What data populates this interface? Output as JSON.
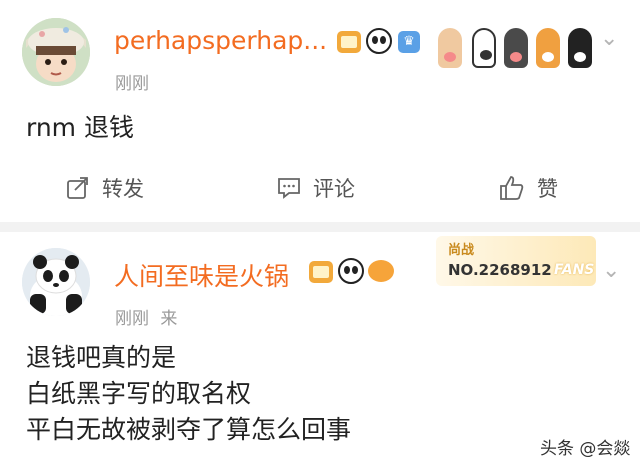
{
  "posts": [
    {
      "username": "perhapsperhap...",
      "time": "刚刚",
      "text_lines": [
        "rnm 退钱"
      ],
      "badges": [
        "crown-badge",
        "panda-badge",
        "vip-badge"
      ],
      "actions": {
        "repost_label": "转发",
        "comment_label": "评论",
        "like_label": "赞"
      }
    },
    {
      "username": "人间至味是火锅",
      "time": "刚刚",
      "source": "来",
      "text_lines": [
        "退钱吧真的是",
        "白纸黑字写的取名权",
        "平白无故被剥夺了算怎么回事"
      ],
      "badges": [
        "crown-badge",
        "panda-badge",
        "fish-badge"
      ],
      "fans_badge": {
        "rank": "尚战",
        "number": "NO.2268912",
        "word": "FANS"
      }
    }
  ],
  "watermark": "头条 @会燚",
  "colors": {
    "username": "#f36c21",
    "time": "#9a9a9a",
    "text": "#222222",
    "separator": "#f2f2f2"
  }
}
